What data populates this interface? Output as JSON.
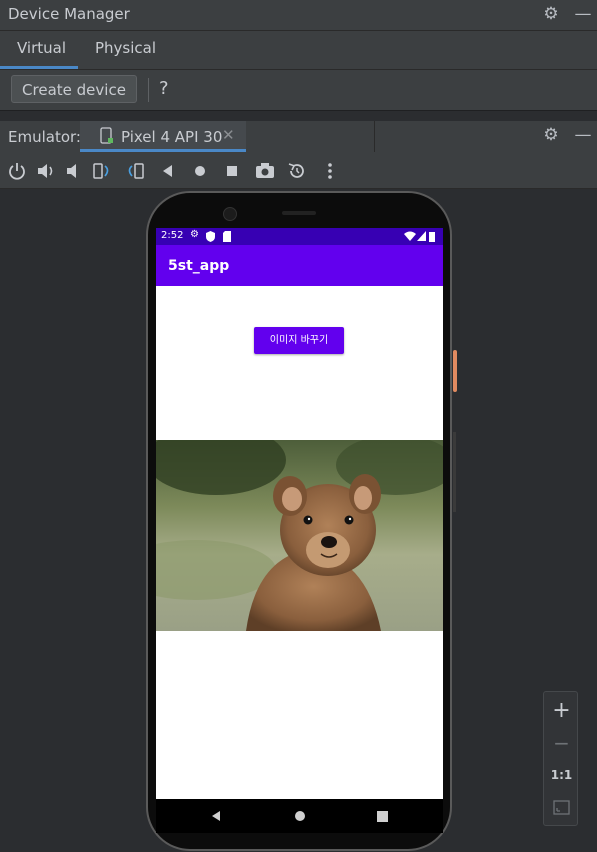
{
  "device_manager": {
    "title": "Device Manager",
    "tabs": [
      {
        "label": "Virtual",
        "active": true
      },
      {
        "label": "Physical",
        "active": false
      }
    ],
    "create_button": "Create device",
    "help": "?"
  },
  "emulator": {
    "label": "Emulator:",
    "tab_label": "Pixel 4 API 30",
    "toolbar_icons": [
      "power-icon",
      "volume-up-icon",
      "volume-down-icon",
      "rotate-left-icon",
      "rotate-right-icon",
      "back-icon",
      "home-icon",
      "overview-icon",
      "screenshot-icon",
      "snapshot-icon",
      "more-icon"
    ]
  },
  "phone": {
    "status_time": "2:52",
    "app_title": "5st_app",
    "button_label": "이미지 바꾸기"
  },
  "zoom": {
    "zoom_in": "+",
    "zoom_out": "−",
    "actual_size": "1:1"
  },
  "colors": {
    "primary": "#6200ee",
    "primary_dark": "#3700b3",
    "accent_tab": "#4a88c7",
    "ide_bg": "#2b2d30"
  }
}
